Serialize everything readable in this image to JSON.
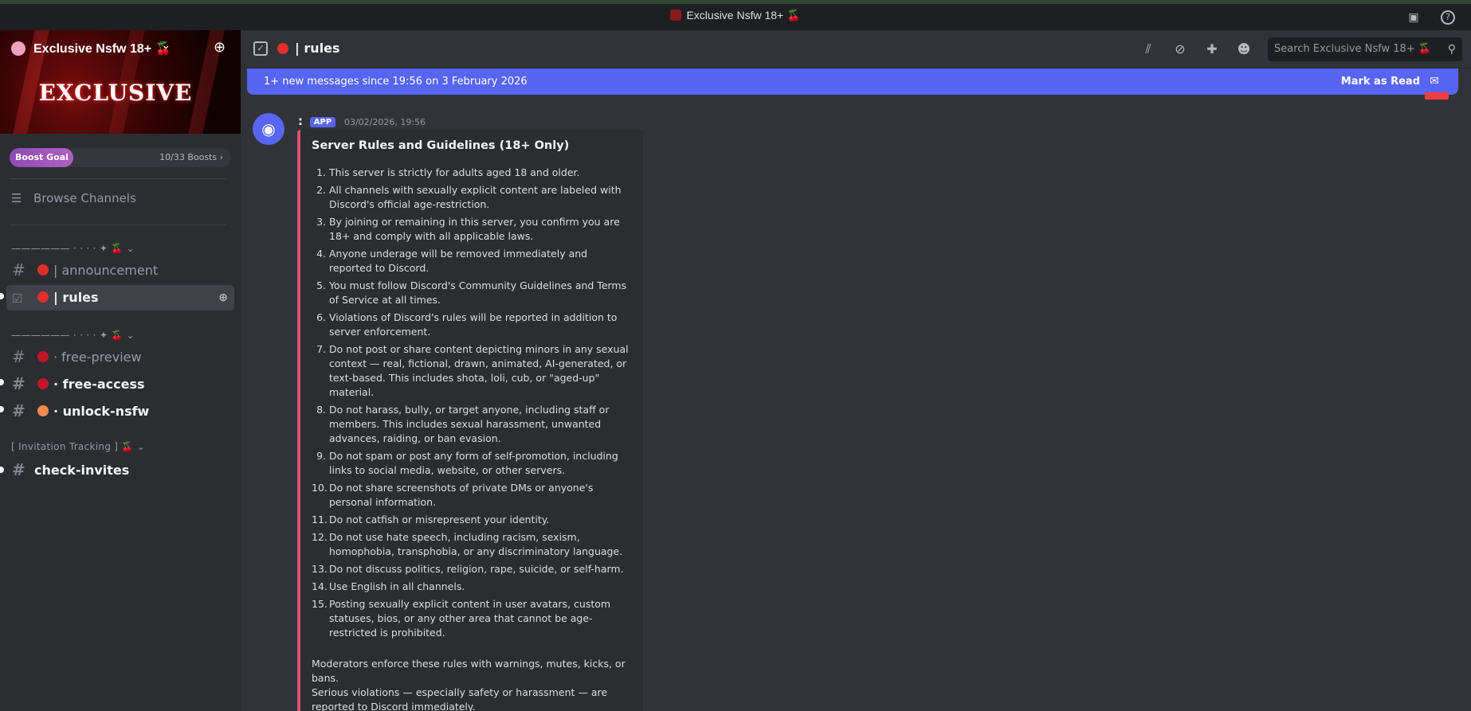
{
  "window": {
    "title": "Exclusive Nsfw 18+ 🍒"
  },
  "server": {
    "name": "Exclusive Nsfw 18+ 🍒",
    "banner_text": "EXCLUSIVE",
    "boost": {
      "label": "Boost Goal",
      "count": "10/33 Boosts ›"
    }
  },
  "sidebar": {
    "browse": "Browse Channels",
    "categories": [
      {
        "label": "—————— · · · · ✦ 🍒 ⌄"
      },
      {
        "label": "—————— · · · · ✦ 🍒 ⌄"
      },
      {
        "label": "[ Invitation Tracking ] 🍒 ⌄"
      }
    ],
    "channels": [
      {
        "name": "| announcement",
        "emoji_color": "#e0302c"
      },
      {
        "name": "| rules",
        "emoji_color": "#e0302c"
      },
      {
        "name": "· free-preview",
        "emoji_color": "#c0162a"
      },
      {
        "name": "· free-access",
        "emoji_color": "#c0162a"
      },
      {
        "name": "· unlock-nsfw",
        "emoji_color": "#f08a50"
      },
      {
        "name": "check-invites"
      }
    ]
  },
  "header": {
    "channel_name": "| rules",
    "search_placeholder": "Search Exclusive Nsfw 18+ 🍒"
  },
  "new_messages": {
    "text": "1+ new messages since 19:56 on 3 February 2026",
    "mark_label": "Mark as Read"
  },
  "message": {
    "author": ":",
    "tag": "APP",
    "timestamp": "03/02/2026, 19:56",
    "embed_title": "Server Rules and Guidelines (18+ Only)",
    "rules": [
      "This server is strictly for adults aged 18 and older.",
      "All channels with sexually explicit content are labeled with Discord's official age-restriction.",
      "By joining or remaining in this server, you confirm you are 18+ and comply with all applicable laws.",
      "Anyone underage will be removed immediately and reported to Discord.",
      "You must follow Discord's Community Guidelines and Terms of Service at all times.",
      "Violations of Discord's rules will be reported in addition to server enforcement.",
      "Do not post or share content depicting minors in any sexual context — real, fictional, drawn, animated, AI-generated, or text-based. This includes shota, loli, cub, or \"aged-up\" material.",
      "Do not harass, bully, or target anyone, including staff or members. This includes sexual harassment, unwanted advances, raiding, or ban evasion.",
      "Do not spam or post any form of self-promotion, including links to social media, website, or other servers.",
      "Do not share screenshots of private DMs or anyone's personal information.",
      "Do not catfish or misrepresent your identity.",
      "Do not use hate speech, including racism, sexism, homophobia, transphobia, or any discriminatory language.",
      "Do not discuss politics, religion, rape, suicide, or self-harm.",
      "Use English in all channels.",
      "Posting sexually explicit content in user avatars, custom statuses, bios, or any other area that cannot be age-restricted is prohibited."
    ],
    "footer_1": "Moderators enforce these rules with warnings, mutes, kicks, or bans.",
    "footer_2": "Serious violations — especially safety or harassment — are reported to Discord immediately."
  }
}
